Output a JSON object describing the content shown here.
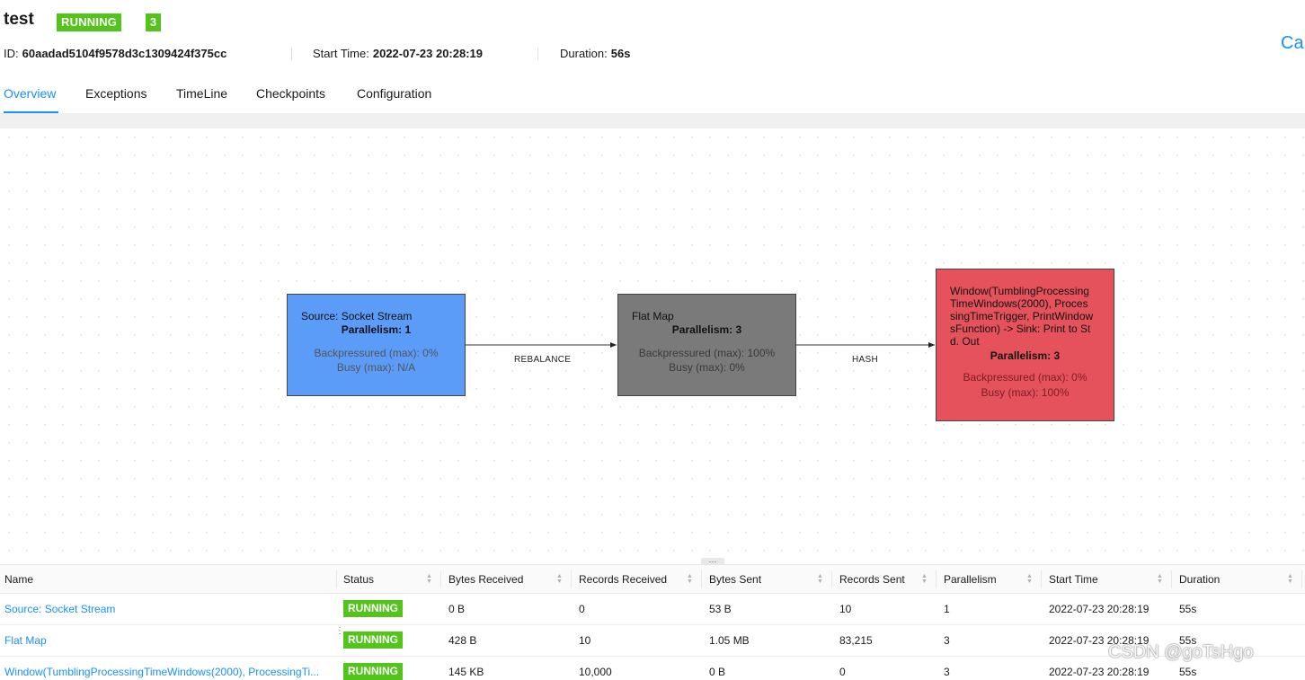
{
  "job": {
    "name": "test",
    "status": "RUNNING",
    "task_count": "3",
    "id_label": "ID:",
    "id": "60aadad5104f9578d3c1309424f375cc",
    "start_label": "Start Time:",
    "start_time": "2022-07-23 20:28:19",
    "duration_label": "Duration:",
    "duration": "56s",
    "cancel_label": "Cancel Job"
  },
  "tabs": [
    "Overview",
    "Exceptions",
    "TimeLine",
    "Checkpoints",
    "Configuration"
  ],
  "graph": {
    "nodes": [
      {
        "name": "Source: Socket Stream",
        "parallelism": "Parallelism: 1",
        "backpressure": "Backpressured (max): 0%",
        "busy": "Busy (max): N/A",
        "color": "#5b9cf9"
      },
      {
        "name": "Flat Map",
        "parallelism": "Parallelism: 3",
        "backpressure": "Backpressured (max): 100%",
        "busy": "Busy (max): 0%",
        "color": "#7a7a7a"
      },
      {
        "name": "Window(TumblingProcessing",
        "name2": "TimeWindows(2000), Proces",
        "name3": "singTimeTrigger, PrintWindow",
        "name4": "sFunction) -> Sink: Print to St",
        "name5": "d. Out",
        "parallelism": "Parallelism: 3",
        "backpressure": "Backpressured (max): 0%",
        "busy": "Busy (max): 100%",
        "color": "#e5525c"
      }
    ],
    "edges": [
      "REBALANCE",
      "HASH"
    ]
  },
  "table": {
    "columns": [
      "Name",
      "Status",
      "Bytes Received",
      "Records Received",
      "Bytes Sent",
      "Records Sent",
      "Parallelism",
      "Start Time",
      "Duration"
    ],
    "rows": [
      {
        "name": "Source: Socket Stream",
        "status": "RUNNING",
        "bytes_received": "0 B",
        "records_received": "0",
        "bytes_sent": "53 B",
        "records_sent": "10",
        "parallelism": "1",
        "start_time": "2022-07-23 20:28:19",
        "duration": "55s"
      },
      {
        "name": "Flat Map",
        "status": "RUNNING",
        "bytes_received": "428 B",
        "records_received": "10",
        "bytes_sent": "1.05 MB",
        "records_sent": "83,215",
        "parallelism": "3",
        "start_time": "2022-07-23 20:28:19",
        "duration": "55s"
      },
      {
        "name": "Window(TumblingProcessingTimeWindows(2000), ProcessingTi...",
        "status": "RUNNING",
        "bytes_received": "145 KB",
        "records_received": "10,000",
        "bytes_sent": "0 B",
        "records_sent": "0",
        "parallelism": "3",
        "start_time": "2022-07-23 20:28:19",
        "duration": "55s"
      }
    ]
  },
  "watermark": "CSDN @goTsHgo",
  "colors": {
    "accent": "#1890ff",
    "running": "#52c41a"
  }
}
